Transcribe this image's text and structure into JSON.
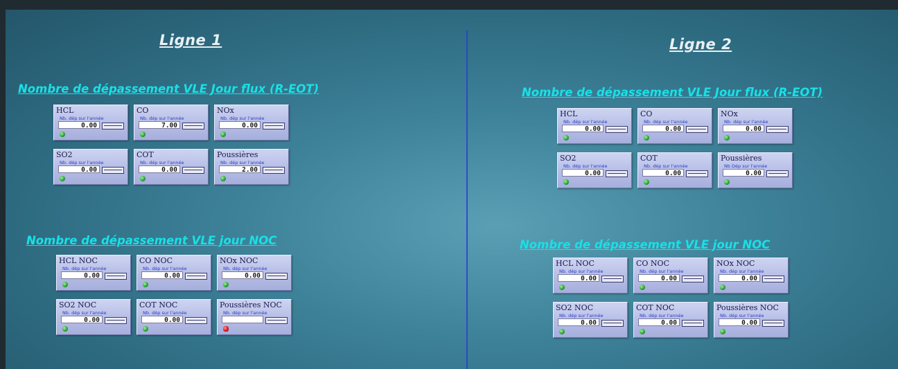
{
  "lines": [
    {
      "title": "Ligne 1",
      "sections": [
        {
          "title": "Nombre de dépassement VLE Jour flux (R-EOT)",
          "panels": [
            {
              "name": "HCL",
              "sub": "Nb. dép sur l'année",
              "value": "0.00",
              "status": "green"
            },
            {
              "name": "CO",
              "sub": "Nb. dép sur l'année",
              "value": "7.00",
              "status": "green"
            },
            {
              "name": "NOx",
              "sub": "Nb. dép sur l'année",
              "value": "0.00",
              "status": "green"
            },
            {
              "name": "SO2",
              "sub": "Nb. dép sur l'année",
              "value": "0.00",
              "status": "green"
            },
            {
              "name": "COT",
              "sub": "Nb. dép sur l'année",
              "value": "0.00",
              "status": "green"
            },
            {
              "name": "Poussières",
              "sub": "Nb. dép sur l'année",
              "value": "2.00",
              "status": "green"
            }
          ]
        },
        {
          "title": "Nombre de dépassement VLE  jour NOC",
          "panels": [
            {
              "name": "HCL NOC",
              "sub": "Nb. dép sur l'année",
              "value": "0.00",
              "status": "green"
            },
            {
              "name": "CO NOC",
              "sub": "Nb. dép sur l'année",
              "value": "0.00",
              "status": "green"
            },
            {
              "name": "NOx NOC",
              "sub": "Nb. dép sur l'année",
              "value": "0.00",
              "status": "green"
            },
            {
              "name": "SO2 NOC",
              "sub": "Nb. dép sur l'année",
              "value": "0.00",
              "status": "green"
            },
            {
              "name": "COT NOC",
              "sub": "Nb. dép sur l'année",
              "value": "0.00",
              "status": "green"
            },
            {
              "name": "Poussières NOC",
              "sub": "Nb. dép sur l'année",
              "value": "",
              "status": "red"
            }
          ]
        }
      ]
    },
    {
      "title": "Ligne 2",
      "sections": [
        {
          "title": "Nombre de dépassement VLE Jour flux (R-EOT)",
          "panels": [
            {
              "name": "HCL",
              "sub": "Nb. dép sur l'année",
              "value": "0.00",
              "status": "green"
            },
            {
              "name": "CO",
              "sub": "Nb. dép sur l'année",
              "value": "0.00",
              "status": "green"
            },
            {
              "name": "NOx",
              "sub": "Nb. dép sur l'année",
              "value": "0.00",
              "status": "green"
            },
            {
              "name": "SO2",
              "sub": "Nb. dép sur l'année",
              "value": "0.00",
              "status": "green"
            },
            {
              "name": "COT",
              "sub": "Nb. dép sur l'année",
              "value": "0.00",
              "status": "green"
            },
            {
              "name": "Poussières",
              "sub": "Nb Dép sur l'année",
              "value": "0.00",
              "status": "green"
            }
          ]
        },
        {
          "title": "Nombre de dépassement VLE  jour NOC",
          "panels": [
            {
              "name": "HCL NOC",
              "sub": "Nb. dép sur l'année",
              "value": "0.00",
              "status": "green"
            },
            {
              "name": "CO NOC",
              "sub": "Nb. dép sur l'année",
              "value": "0.00",
              "status": "green"
            },
            {
              "name": "NOx NOC",
              "sub": "Nb. dép sur l'année",
              "value": "0.00",
              "status": "green"
            },
            {
              "name": "SO2  NOC",
              "sub": "Nb. dép sur l'année",
              "value": "0.00",
              "status": "green"
            },
            {
              "name": "COT  NOC",
              "sub": "Nb. dép sur l'année",
              "value": "0.00",
              "status": "green"
            },
            {
              "name": "Poussières  NOC",
              "sub": "Nb. dép sur l'année",
              "value": "0.00",
              "status": "green"
            }
          ]
        }
      ]
    }
  ],
  "colors": {
    "background": "#3d8198",
    "section_title": "#19e0e6",
    "line_title": "#e8f0f4",
    "divider": "#2a3fd0",
    "status_green": "#2fa53a",
    "status_red": "#d81e1e"
  }
}
